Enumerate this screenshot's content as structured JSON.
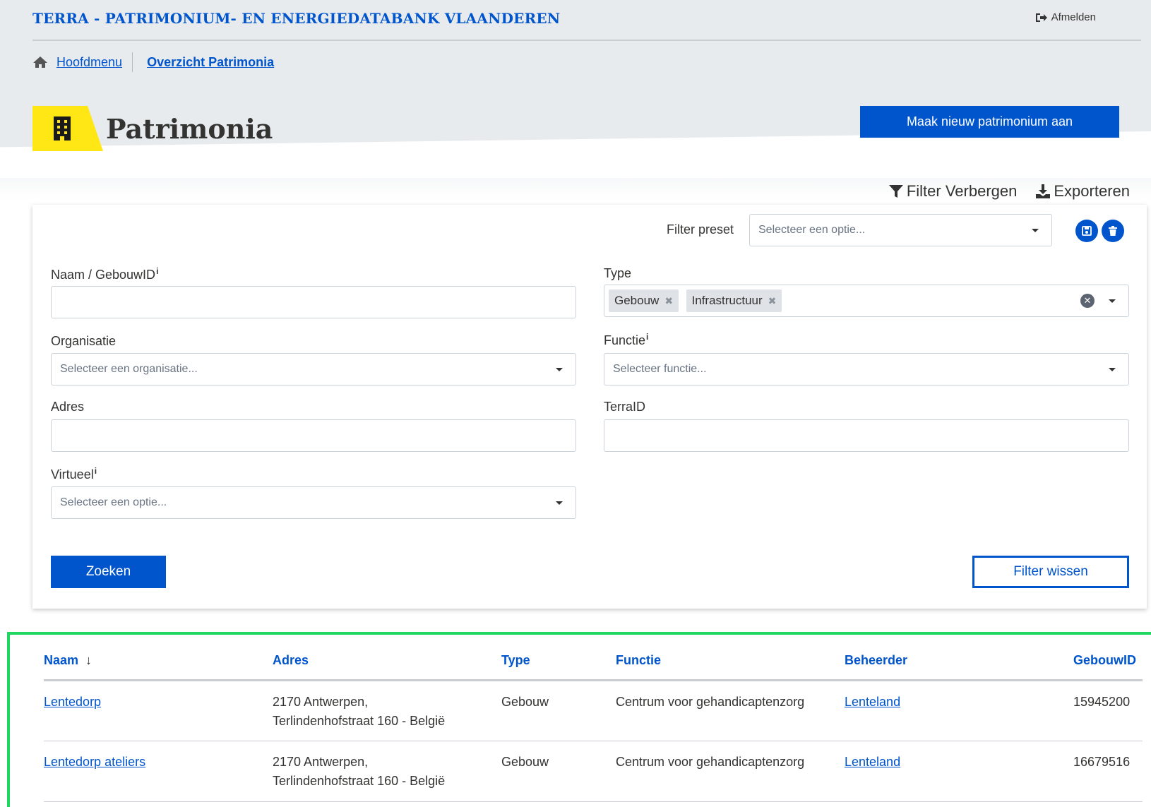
{
  "header": {
    "app_title": "TERRA - PATRIMONIUM- EN ENERGIEDATABANK VLAANDEREN",
    "logout_label": "Afmelden"
  },
  "breadcrumb": {
    "home_label": "Hoofdmenu",
    "current_label": "Overzicht Patrimonia"
  },
  "page": {
    "title": "Patrimonia",
    "create_button": "Maak nieuw patrimonium aan"
  },
  "toolbar": {
    "filter_toggle": "Filter Verbergen",
    "export": "Exporteren"
  },
  "filters": {
    "preset_label": "Filter preset",
    "preset_placeholder": "Selecteer een optie...",
    "name_label": "Naam / GebouwID",
    "info_marker": "i",
    "type_label": "Type",
    "type_chips": [
      "Gebouw",
      "Infrastructuur"
    ],
    "chip_remove": "✖",
    "organisation_label": "Organisatie",
    "organisation_placeholder": "Selecteer een organisatie...",
    "function_label": "Functie",
    "function_placeholder": "Selecteer functie...",
    "address_label": "Adres",
    "terraid_label": "TerraID",
    "virtual_label": "Virtueel",
    "virtual_placeholder": "Selecteer een optie...",
    "search_button": "Zoeken",
    "clear_button": "Filter wissen"
  },
  "table": {
    "columns": [
      "Naam",
      "Adres",
      "Type",
      "Functie",
      "Beheerder",
      "GebouwID"
    ],
    "sort_arrow": "↓",
    "rows": [
      {
        "naam": "Lentedorp",
        "adres_line1": "2170 Antwerpen,",
        "adres_line2": "Terlindenhofstraat 160 - België",
        "type": "Gebouw",
        "functie": "Centrum voor gehandicaptenzorg",
        "beheerder": "Lenteland",
        "gebouwid": "15945200"
      },
      {
        "naam": "Lentedorp ateliers",
        "adres_line1": "2170 Antwerpen,",
        "adres_line2": "Terlindenhofstraat 160 - België",
        "type": "Gebouw",
        "functie": "Centrum voor gehandicaptenzorg",
        "beheerder": "Lenteland",
        "gebouwid": "16679516"
      }
    ]
  },
  "colors": {
    "brand_blue": "#0055cc",
    "accent_yellow": "#ffe615",
    "highlight_green": "#1ed760",
    "header_grey": "#e8ebee"
  }
}
